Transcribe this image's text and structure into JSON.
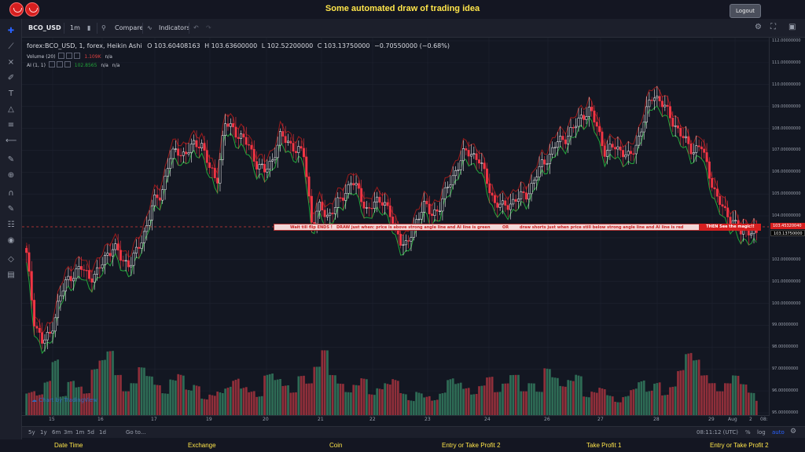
{
  "header": {
    "title": "Some automated draw of trading idea",
    "logout_label": "Logout"
  },
  "toolbar": {
    "symbol": "BCO_USD",
    "interval": "1m",
    "compare_label": "Compare",
    "indicators_label": "Indicators"
  },
  "legend": {
    "main": "forex:BCO_USD, 1, forex, Heikin Ashi",
    "open": "O 103.60408163",
    "high": "H 103.63600000",
    "low": "L 102.52200000",
    "close": "C 103.13750000",
    "change": "−0.70550000 (−0.68%)",
    "volume_label": "Volume (20)",
    "volume_value": "1.109K",
    "volume_na": "n/a",
    "ai_label": "AI (1, 1)",
    "ai_value": "102.8565",
    "ai_na1": "n/a",
    "ai_na2": "n/a"
  },
  "banner": {
    "part1": "Wait till flip ENDS !",
    "part2": "DRAW just when:  price is above strong angle line and AI line is green",
    "part3": "OR",
    "part4": "draw shorts just when price still below strong angle line and AI line is red",
    "magic": "THEN See the magic!!"
  },
  "price_axis": {
    "labels": [
      "112.00000000",
      "111.00000000",
      "110.00000000",
      "109.00000000",
      "108.00000000",
      "107.00000000",
      "106.00000000",
      "105.00000000",
      "104.00000000",
      "102.00000000",
      "101.00000000",
      "100.00000000",
      "99.00000000",
      "98.00000000",
      "97.00000000",
      "96.00000000",
      "95.00000000"
    ],
    "tag_red": "103.45320040",
    "tag_black": "103.13750000"
  },
  "date_axis": {
    "labels": [
      "15",
      "16",
      "17",
      "19",
      "20",
      "21",
      "22",
      "23",
      "24",
      "26",
      "27",
      "28",
      "29",
      "Aug",
      "2",
      "08:"
    ]
  },
  "bottom_bar": {
    "ranges": [
      "5y",
      "1y",
      "6m",
      "3m",
      "1m",
      "5d",
      "1d"
    ],
    "goto": "Go to...",
    "time": "08:11:12 (UTC)",
    "percent": "%",
    "log": "log",
    "auto": "auto"
  },
  "watermark": "Chart by TradingView",
  "footer": {
    "items": [
      "Date Time",
      "Exchange",
      "Coin",
      "Entry or Take Profit 2",
      "Take Profit 1",
      "Entry or Take Profit 2"
    ]
  },
  "colors": {
    "up": "#ffffff",
    "down": "#f23645",
    "vol_up": "#2e6b55",
    "vol_down": "#8f2f3a",
    "ai_green": "#22a63a",
    "ai_red": "#9b1b1b",
    "accent": "#ffe54a"
  },
  "chart_data": {
    "type": "candlestick",
    "xlabel": "",
    "ylabel": "",
    "ylim": [
      95,
      112
    ],
    "close_path_points": [
      102.2,
      99.2,
      98.2,
      98.6,
      100.0,
      101.0,
      101.4,
      101.6,
      101.2,
      101.4,
      102.2,
      102.6,
      102.0,
      101.8,
      102.4,
      103.4,
      104.6,
      105.0,
      106.6,
      107.0,
      106.8,
      107.2,
      107.4,
      106.2,
      105.6,
      108.2,
      108.0,
      107.6,
      107.2,
      106.4,
      106.0,
      106.6,
      107.6,
      107.4,
      107.0,
      106.8,
      103.6,
      104.4,
      104.0,
      104.4,
      105.0,
      105.6,
      105.0,
      104.2,
      104.6,
      104.8,
      103.8,
      103.0,
      102.6,
      103.6,
      104.6,
      104.0,
      104.4,
      105.2,
      106.0,
      106.8,
      106.9,
      106.6,
      105.6,
      104.6,
      104.4,
      104.6,
      104.8,
      105.0,
      105.6,
      106.4,
      106.8,
      107.4,
      107.6,
      108.0,
      108.6,
      108.8,
      108.0,
      106.8,
      107.2,
      107.0,
      106.6,
      107.4,
      108.6,
      109.6,
      109.2,
      108.6,
      108.0,
      107.4,
      107.0,
      107.2,
      106.0,
      104.8,
      104.2,
      103.8,
      103.2,
      103.4,
      103.1
    ],
    "volume_pattern_points": [
      0.5,
      0.4,
      0.6,
      0.9,
      0.3,
      0.5,
      0.4,
      0.3,
      0.6,
      0.7,
      0.8,
      0.5,
      0.3,
      0.4,
      0.6,
      0.5,
      0.4,
      0.3,
      0.5,
      0.6,
      0.4,
      0.5,
      0.3,
      0.4,
      0.5,
      0.6,
      0.7,
      0.5,
      0.4,
      0.3,
      0.6,
      0.5,
      0.4,
      0.3,
      0.5,
      0.4,
      0.6,
      0.8,
      0.5,
      0.4,
      0.3,
      0.4,
      0.5,
      0.3,
      0.4,
      0.5,
      0.6,
      0.4,
      0.3,
      0.5,
      0.4,
      0.3,
      0.4,
      0.6,
      0.5,
      0.4,
      0.3,
      0.4,
      0.5,
      0.3,
      0.4,
      0.5,
      0.3,
      0.4,
      0.3,
      0.6,
      0.5,
      0.4,
      0.5,
      0.6,
      0.3,
      0.4,
      0.5,
      0.4,
      0.3,
      0.4,
      0.5,
      0.6,
      0.4,
      0.5,
      0.3,
      0.4,
      0.6,
      0.8,
      0.7,
      0.5,
      0.4,
      0.3,
      0.4,
      0.5,
      0.4,
      0.3,
      0.2
    ]
  }
}
